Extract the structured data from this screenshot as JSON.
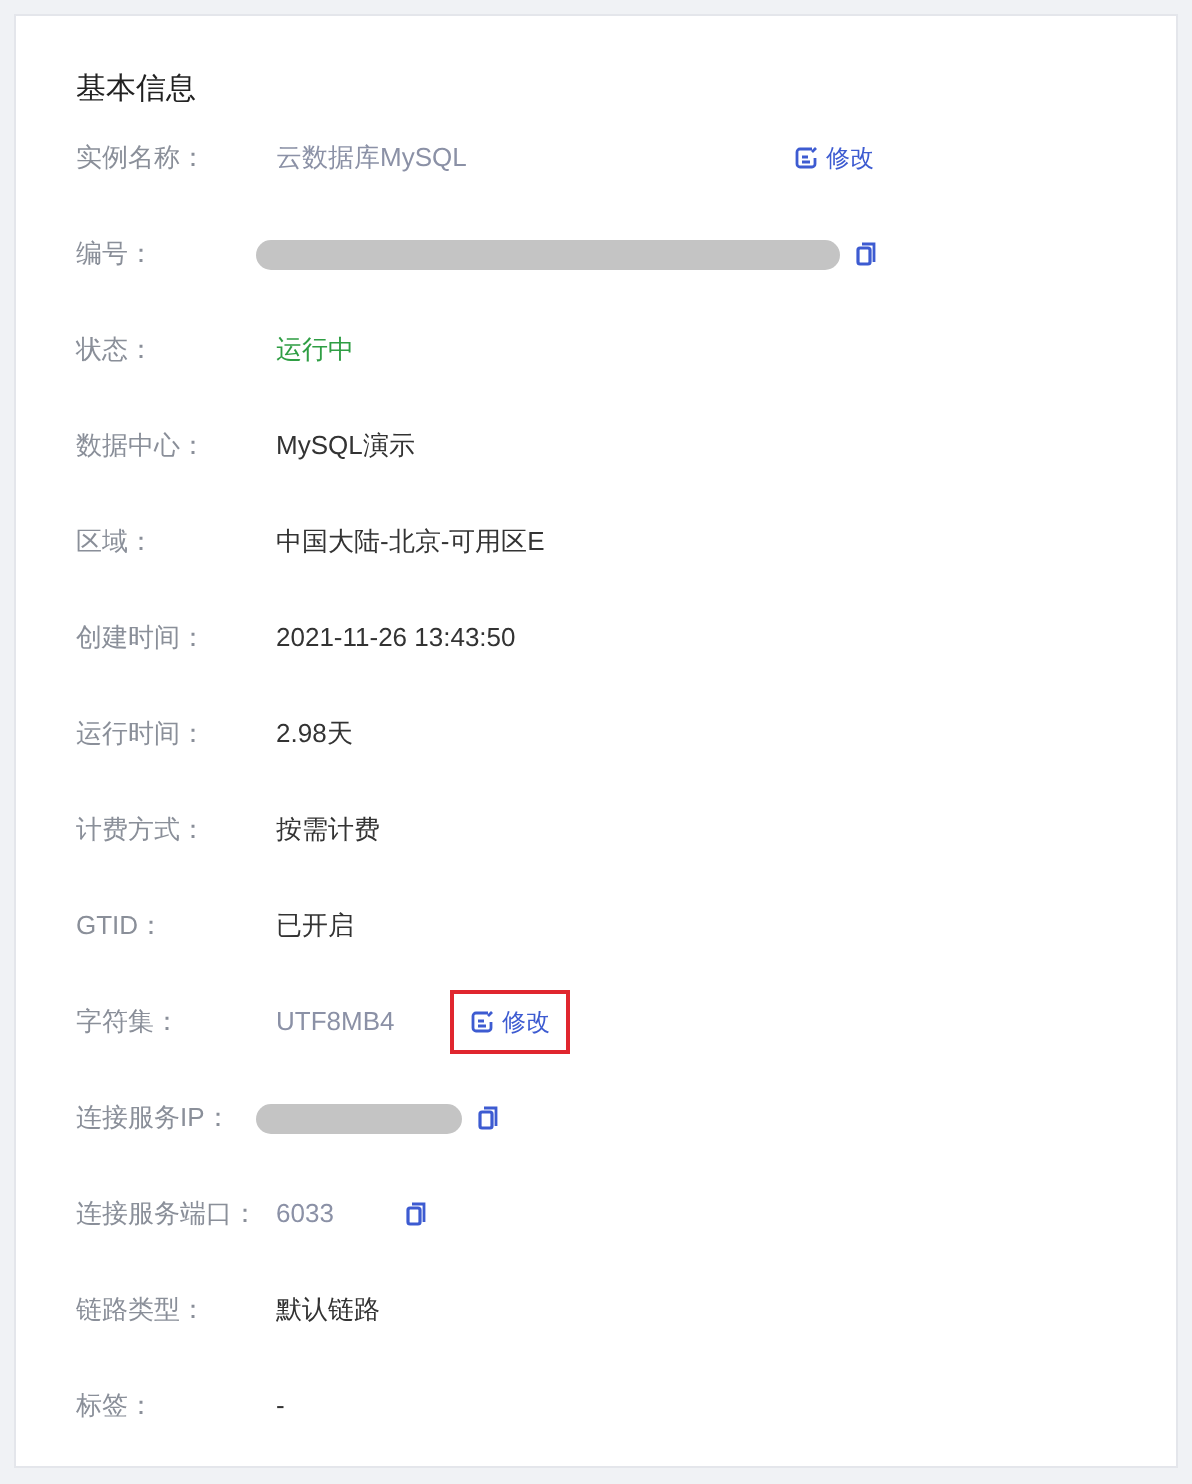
{
  "section_title": "基本信息",
  "rows": [
    {
      "label": "实例名称：",
      "kind": "muted_text",
      "value": "云数据库MySQL",
      "edit": {
        "label": "修改",
        "highlighted": false,
        "kind": "aligned"
      }
    },
    {
      "label": "编号：",
      "kind": "masked_long",
      "copy": true
    },
    {
      "label": "状态：",
      "kind": "success_text",
      "value": "运行中"
    },
    {
      "label": "数据中心：",
      "kind": "text",
      "value": "MySQL演示"
    },
    {
      "label": "区域：",
      "kind": "text",
      "value": "中国大陆-北京-可用区E"
    },
    {
      "label": "创建时间：",
      "kind": "text",
      "value": "2021-11-26 13:43:50"
    },
    {
      "label": "运行时间：",
      "kind": "text",
      "value": "2.98天"
    },
    {
      "label": "计费方式：",
      "kind": "text",
      "value": "按需计费"
    },
    {
      "label": "GTID：",
      "kind": "text",
      "value": "已开启"
    },
    {
      "label": "字符集：",
      "kind": "muted_text",
      "value": "UTF8MB4",
      "edit": {
        "label": "修改",
        "highlighted": true,
        "kind": "inline"
      }
    },
    {
      "label": "连接服务IP：",
      "kind": "masked_short",
      "copy": true
    },
    {
      "label": "连接服务端口：",
      "kind": "muted_text",
      "value": "6033",
      "copy": true
    },
    {
      "label": "链路类型：",
      "kind": "text",
      "value": "默认链路"
    },
    {
      "label": "标签：",
      "kind": "text",
      "value": "-"
    }
  ]
}
